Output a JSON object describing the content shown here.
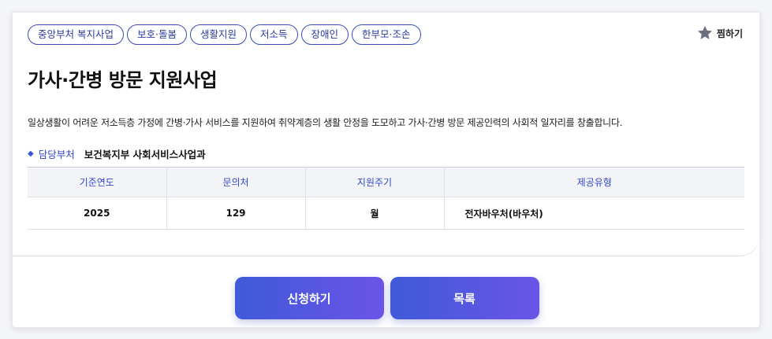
{
  "tags": [
    "중앙부처 복지사업",
    "보호·돌봄",
    "생활지원",
    "저소득",
    "장애인",
    "한부모·조손"
  ],
  "favorite": {
    "label": "찜하기",
    "icon": "star-icon",
    "icon_color": "#6b6e7c"
  },
  "title": "가사·간병 방문 지원사업",
  "description": "일상생활이 어려운 저소득층 가정에 간병·가사 서비스를 지원하여 취약계층의 생활 안정을 도모하고 가사·간병 방문 제공인력의 사회적 일자리를 창출합니다.",
  "department": {
    "label": "담당부처",
    "value": "보건복지부 사회서비스사업과"
  },
  "table": {
    "headers": [
      "기준연도",
      "문의처",
      "지원주기",
      "제공유형"
    ],
    "row": [
      "2025",
      "129",
      "월",
      "전자바우처(바우처)"
    ]
  },
  "buttons": {
    "apply": "신청하기",
    "list": "목록"
  },
  "colors": {
    "accent": "#3b4db3",
    "button_start": "#3f5ad8",
    "button_end": "#6b54e8"
  }
}
